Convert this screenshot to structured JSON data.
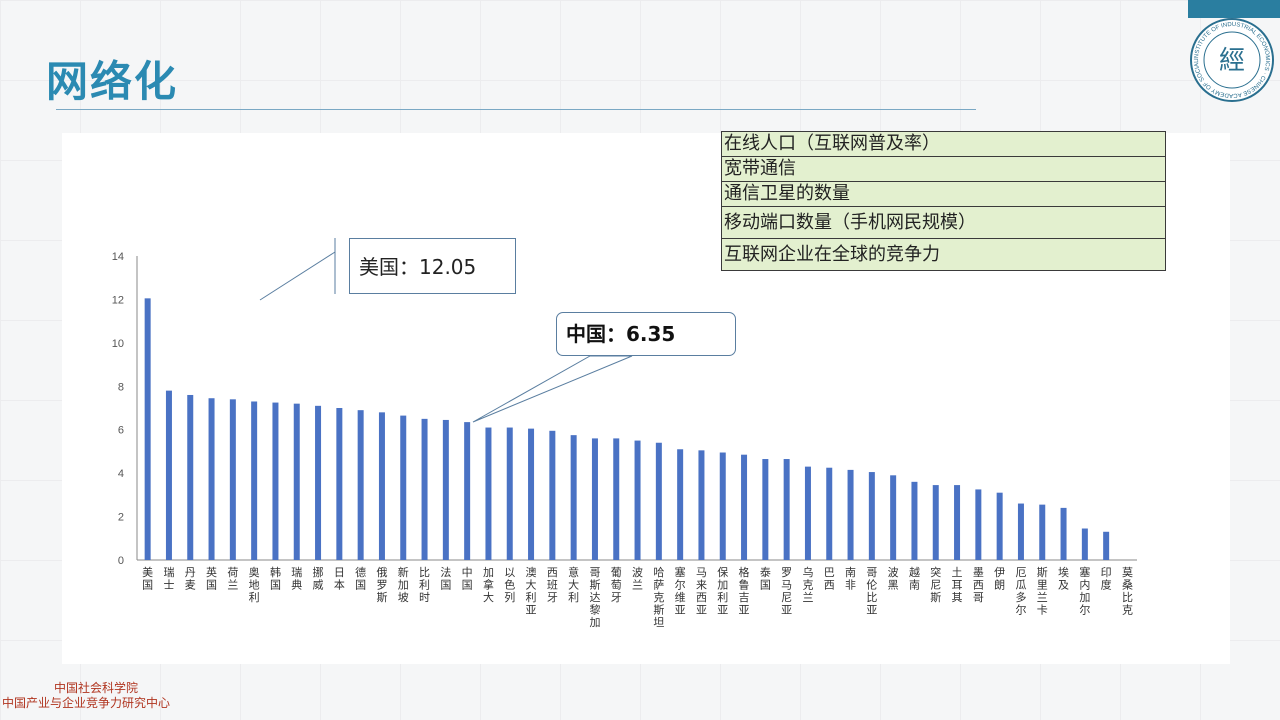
{
  "page": {
    "title": "网络化",
    "footer_line1": "中国社会科学院",
    "footer_line2": "中国产业与企业竞争力研究中心",
    "logo_ring_text": "INSTITUTE OF INDUSTRIAL ECONOMICS · CHINESE ACADEMY OF SOCIAL SCIENCES ·",
    "accent_color": "#2b8ab2",
    "bar_color": "#4a72c4",
    "footer_color": "#b0341f"
  },
  "indicators": [
    "在线人口（互联网普及率）",
    "宽带通信",
    "通信卫星的数量",
    "移动端口数量（手机网民规模）",
    "互联网企业在全球的竞争力"
  ],
  "callouts": {
    "usa": "美国：12.05",
    "china": "中国：6.35"
  },
  "chart_data": {
    "type": "bar",
    "ylim": [
      0,
      14
    ],
    "yticks": [
      0,
      2,
      4,
      6,
      8,
      10,
      12,
      14
    ],
    "grid": false,
    "categories": [
      "美国",
      "瑞士",
      "丹麦",
      "英国",
      "荷兰",
      "奥地利",
      "韩国",
      "瑞典",
      "挪威",
      "日本",
      "德国",
      "俄罗斯",
      "新加坡",
      "比利时",
      "法国",
      "中国",
      "加拿大",
      "以色列",
      "澳大利亚",
      "西班牙",
      "意大利",
      "哥斯达黎加",
      "葡萄牙",
      "波兰",
      "哈萨克斯坦",
      "塞尔维亚",
      "马来西亚",
      "保加利亚",
      "格鲁吉亚",
      "泰国",
      "罗马尼亚",
      "乌克兰",
      "巴西",
      "南非",
      "哥伦比亚",
      "波黑",
      "越南",
      "突尼斯",
      "土耳其",
      "墨西哥",
      "伊朗",
      "厄瓜多尔",
      "斯里兰卡",
      "埃及",
      "塞内加尔",
      "印度",
      "莫桑比克"
    ],
    "values": [
      12.05,
      7.8,
      7.6,
      7.45,
      7.4,
      7.3,
      7.25,
      7.2,
      7.1,
      7.0,
      6.9,
      6.8,
      6.65,
      6.5,
      6.45,
      6.35,
      6.1,
      6.1,
      6.05,
      5.95,
      5.75,
      5.6,
      5.6,
      5.5,
      5.4,
      5.1,
      5.05,
      4.95,
      4.85,
      4.65,
      4.65,
      4.3,
      4.25,
      4.15,
      4.05,
      3.9,
      3.6,
      3.45,
      3.45,
      3.25,
      3.1,
      2.6,
      2.55,
      2.4,
      1.45,
      1.3,
      0
    ]
  }
}
